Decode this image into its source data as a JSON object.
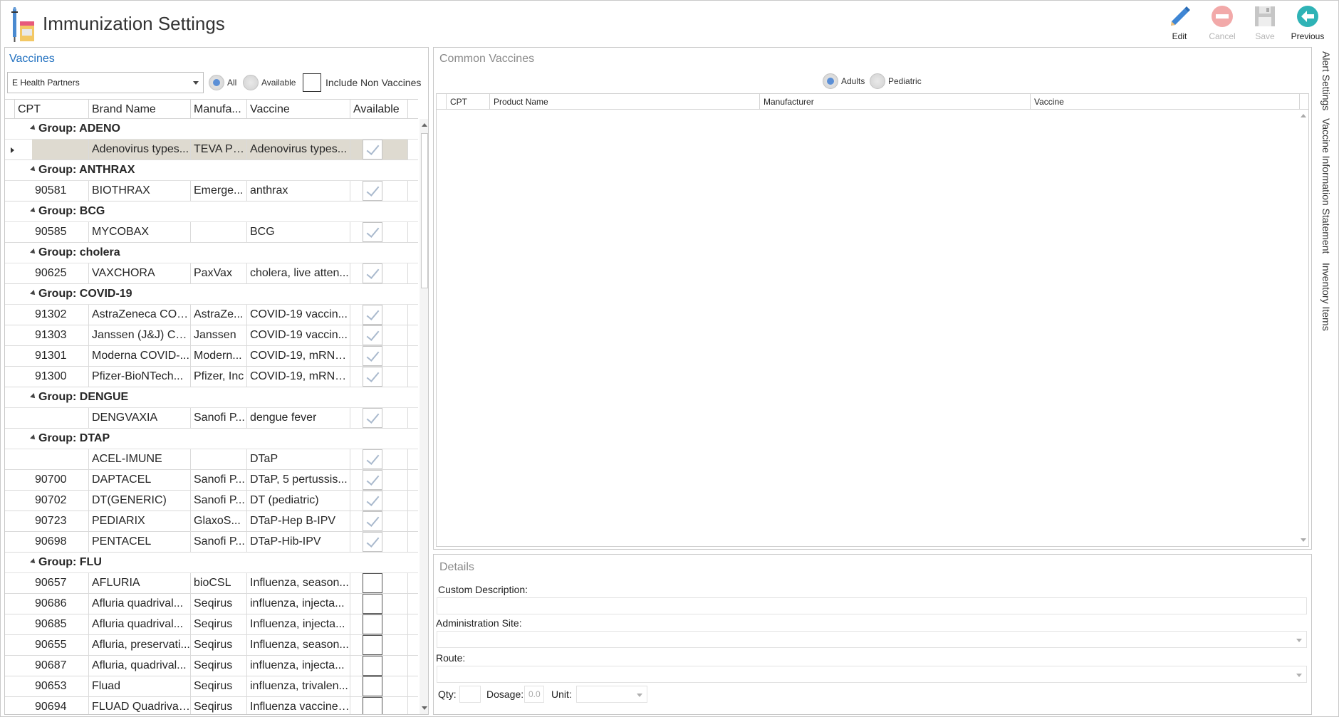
{
  "header": {
    "title": "Immunization Settings"
  },
  "toolbar": [
    {
      "label": "Edit",
      "icon": "pencil-icon",
      "enabled": true
    },
    {
      "label": "Cancel",
      "icon": "cancel-icon",
      "enabled": false
    },
    {
      "label": "Save",
      "icon": "save-icon",
      "enabled": false
    },
    {
      "label": "Previous",
      "icon": "back-arrow-icon",
      "enabled": true
    }
  ],
  "left": {
    "section_title": "Vaccines",
    "partner_select": "E Health Partners",
    "filter_all": "All",
    "filter_available": "Available",
    "include_non_vaccines": "Include Non Vaccines",
    "columns": [
      "CPT",
      "Brand Name",
      "Manufa...",
      "Vaccine",
      "Available"
    ]
  },
  "groups": [
    {
      "name": "Group: ADENO",
      "rows": [
        {
          "cpt": "",
          "brand": "Adenovirus types...",
          "mfr": "TEVA Ph...",
          "vaccine": "Adenovirus types...",
          "available": true,
          "selected": true
        }
      ]
    },
    {
      "name": "Group: ANTHRAX",
      "rows": [
        {
          "cpt": "90581",
          "brand": "BIOTHRAX",
          "mfr": "Emerge...",
          "vaccine": "anthrax",
          "available": true
        }
      ]
    },
    {
      "name": "Group: BCG",
      "rows": [
        {
          "cpt": "90585",
          "brand": "MYCOBAX",
          "mfr": "",
          "vaccine": "BCG",
          "available": true
        }
      ]
    },
    {
      "name": "Group: cholera",
      "rows": [
        {
          "cpt": "90625",
          "brand": "VAXCHORA",
          "mfr": "PaxVax",
          "vaccine": "cholera, live atten...",
          "available": true
        }
      ]
    },
    {
      "name": "Group: COVID-19",
      "rows": [
        {
          "cpt": "91302",
          "brand": "AstraZeneca COV...",
          "mfr": "AstraZe...",
          "vaccine": "COVID-19 vaccin...",
          "available": true
        },
        {
          "cpt": "91303",
          "brand": "Janssen (J&J) CO...",
          "mfr": "Janssen",
          "vaccine": "COVID-19 vaccin...",
          "available": true
        },
        {
          "cpt": "91301",
          "brand": "Moderna COVID-...",
          "mfr": "Modern...",
          "vaccine": "COVID-19, mRNA...",
          "available": true
        },
        {
          "cpt": "91300",
          "brand": "Pfizer-BioNTech...",
          "mfr": "Pfizer, Inc",
          "vaccine": "COVID-19, mRNA...",
          "available": true
        }
      ]
    },
    {
      "name": "Group: DENGUE",
      "rows": [
        {
          "cpt": "",
          "brand": "DENGVAXIA",
          "mfr": "Sanofi P...",
          "vaccine": "dengue fever",
          "available": true
        }
      ]
    },
    {
      "name": "Group: DTAP",
      "rows": [
        {
          "cpt": "",
          "brand": "ACEL-IMUNE",
          "mfr": "",
          "vaccine": "DTaP",
          "available": true
        },
        {
          "cpt": "90700",
          "brand": "DAPTACEL",
          "mfr": "Sanofi P...",
          "vaccine": "DTaP, 5 pertussis...",
          "available": true
        },
        {
          "cpt": "90702",
          "brand": "DT(GENERIC)",
          "mfr": "Sanofi P...",
          "vaccine": "DT (pediatric)",
          "available": true
        },
        {
          "cpt": "90723",
          "brand": "PEDIARIX",
          "mfr": "GlaxoS...",
          "vaccine": "DTaP-Hep B-IPV",
          "available": true
        },
        {
          "cpt": "90698",
          "brand": "PENTACEL",
          "mfr": "Sanofi P...",
          "vaccine": "DTaP-Hib-IPV",
          "available": true
        }
      ]
    },
    {
      "name": "Group: FLU",
      "rows": [
        {
          "cpt": "90657",
          "brand": "AFLURIA",
          "mfr": "bioCSL",
          "vaccine": "Influenza, season...",
          "available": false
        },
        {
          "cpt": "90686",
          "brand": "Afluria quadrival...",
          "mfr": "Seqirus",
          "vaccine": "influenza, injecta...",
          "available": false
        },
        {
          "cpt": "90685",
          "brand": "Afluria quadrival...",
          "mfr": "Seqirus",
          "vaccine": "Influenza, injecta...",
          "available": false
        },
        {
          "cpt": "90655",
          "brand": "Afluria, preservati...",
          "mfr": "Seqirus",
          "vaccine": "Influenza, season...",
          "available": false
        },
        {
          "cpt": "90687",
          "brand": "Afluria, quadrival...",
          "mfr": "Seqirus",
          "vaccine": "influenza, injecta...",
          "available": false
        },
        {
          "cpt": "90653",
          "brand": "Fluad",
          "mfr": "Seqirus",
          "vaccine": "influenza, trivalen...",
          "available": false
        },
        {
          "cpt": "90694",
          "brand": "FLUAD Quadrival...",
          "mfr": "Seqirus",
          "vaccine": "Influenza vaccine,...",
          "available": false
        }
      ]
    }
  ],
  "common": {
    "section_title": "Common Vaccines",
    "adults": "Adults",
    "pediatric": "Pediatric",
    "columns": [
      "CPT",
      "Product Name",
      "Manufacturer",
      "Vaccine"
    ]
  },
  "details": {
    "section_title": "Details",
    "custom_description": "Custom Description:",
    "administration_site": "Administration Site:",
    "route": "Route:",
    "qty": "Qty:",
    "dosage": "Dosage:",
    "dosage_value": "0.0",
    "unit": "Unit:"
  },
  "side_tabs": [
    "Alert Settings",
    "Vaccine Information Statement",
    "Inventory Items"
  ]
}
